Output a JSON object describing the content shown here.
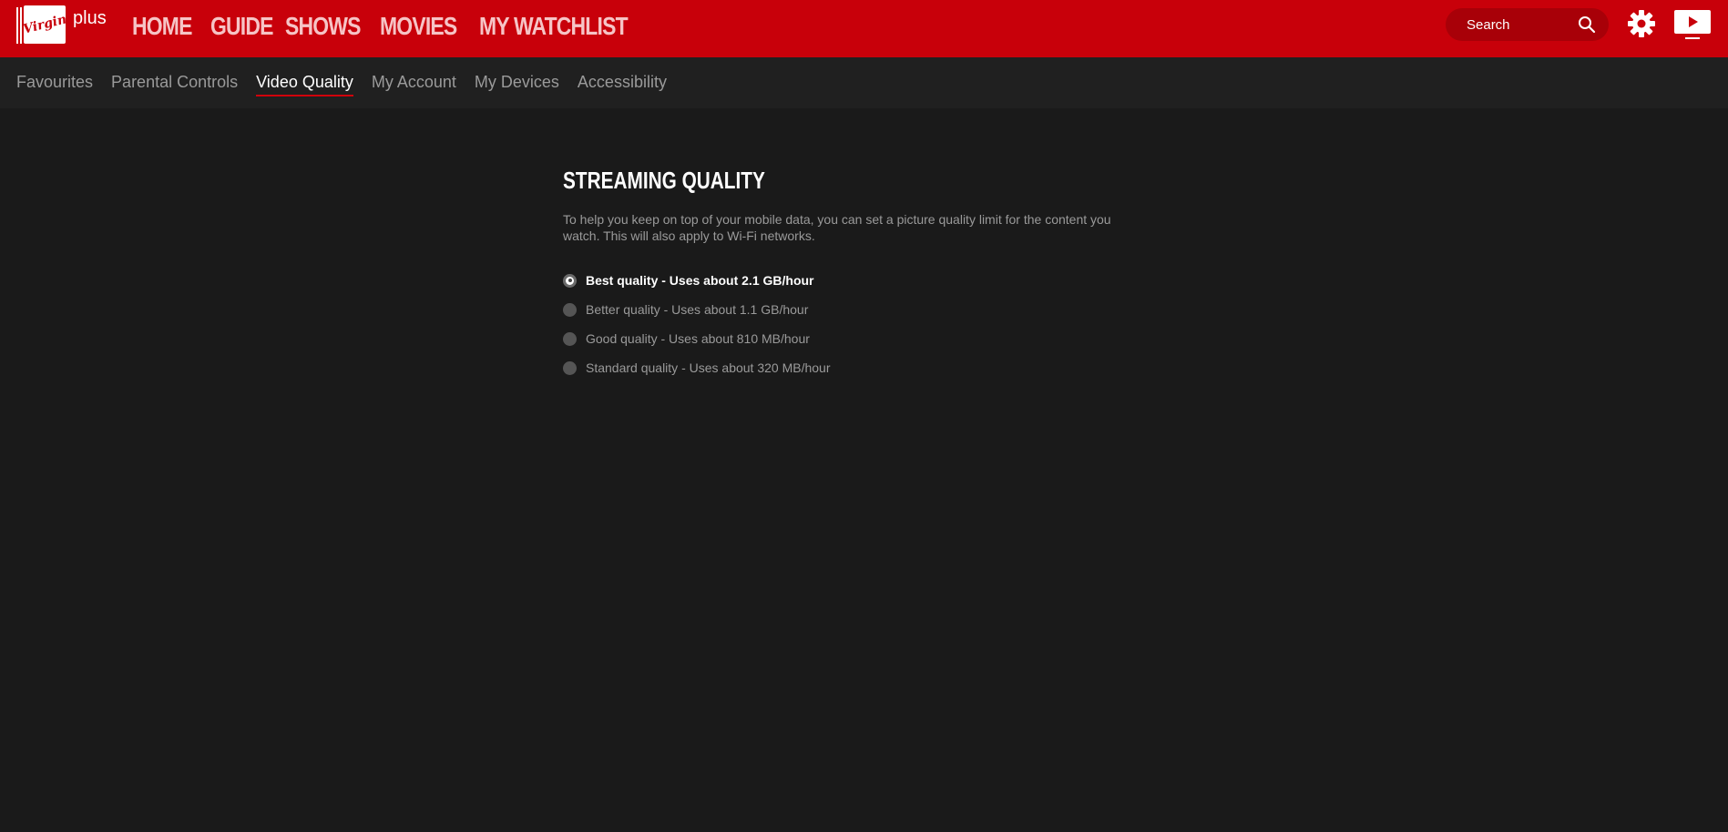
{
  "brand": {
    "logo_script": "Virgin",
    "logo_suffix": "plus",
    "accent_color": "#c8000a"
  },
  "main_nav": {
    "items": [
      {
        "label": "HOME"
      },
      {
        "label": "GUIDE"
      },
      {
        "label": "SHOWS"
      },
      {
        "label": "MOVIES"
      },
      {
        "label": "MY WATCHLIST"
      }
    ]
  },
  "header": {
    "search_placeholder": "Search",
    "search_icon": "search-icon",
    "settings_icon": "gear-icon",
    "tv_icon": "tv-play-icon"
  },
  "sub_nav": {
    "items": [
      {
        "label": "Favourites",
        "active": false
      },
      {
        "label": "Parental Controls",
        "active": false
      },
      {
        "label": "Video Quality",
        "active": true
      },
      {
        "label": "My Account",
        "active": false
      },
      {
        "label": "My Devices",
        "active": false
      },
      {
        "label": "Accessibility",
        "active": false
      }
    ]
  },
  "streaming": {
    "title": "STREAMING QUALITY",
    "description": "To help you keep on top of your mobile data, you can set a picture quality limit for the content you watch. This will also apply to Wi-Fi networks.",
    "options": [
      {
        "label": "Best quality - Uses about 2.1 GB/hour",
        "selected": true
      },
      {
        "label": "Better quality - Uses about 1.1 GB/hour",
        "selected": false
      },
      {
        "label": "Good quality - Uses about 810 MB/hour",
        "selected": false
      },
      {
        "label": "Standard quality - Uses about 320 MB/hour",
        "selected": false
      }
    ]
  }
}
